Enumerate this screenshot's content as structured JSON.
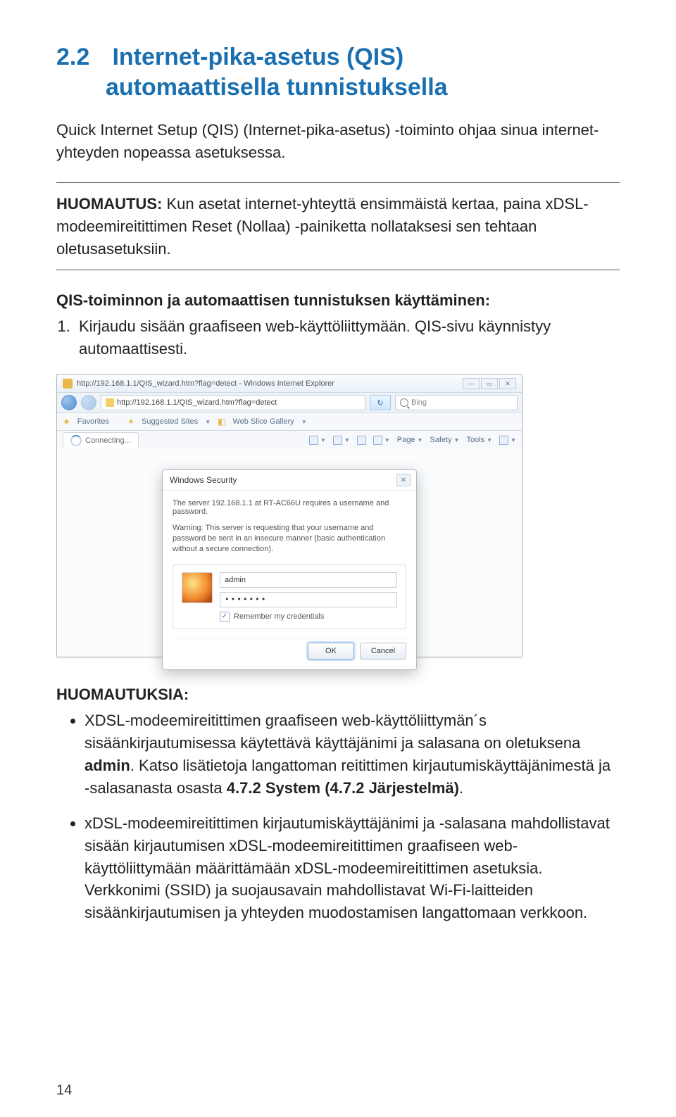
{
  "heading": {
    "number": "2.2",
    "title_line1": "Internet-pika-asetus (QIS)",
    "title_line2": "automaattisella tunnistuksella"
  },
  "intro": "Quick Internet Setup (QIS) (Internet-pika-asetus) -toiminto ohjaa sinua internet-yhteyden nopeassa asetuksessa.",
  "note_block": {
    "label": "HUOMAUTUS:",
    "text": " Kun asetat internet-yhteyttä ensimmäistä kertaa, paina xDSL-modeemireitittimen Reset (Nollaa) -painiketta nollataksesi sen tehtaan oletusasetuksiin."
  },
  "subheading": "QIS-toiminnon ja automaattisen tunnistuksen käyttäminen:",
  "step1": "Kirjaudu sisään graafiseen web-käyttöliittymään. QIS-sivu käynnistyy automaattisesti.",
  "browser": {
    "window_title": "http://192.168.1.1/QIS_wizard.htm?flag=detect - Windows Internet Explorer",
    "url": "http://192.168.1.1/QIS_wizard.htm?flag=detect",
    "search_placeholder": "Bing",
    "favorites_label": "Favorites",
    "suggested_label": "Suggested Sites",
    "webslice_label": "Web Slice Gallery",
    "tab_label": "Connecting...",
    "tool_page": "Page",
    "tool_safety": "Safety",
    "tool_tools": "Tools",
    "dialog": {
      "title": "Windows Security",
      "server_line": "The server 192.168.1.1 at RT-AC66U requires a username and password.",
      "warning": "Warning: This server is requesting that your username and password be sent in an insecure manner (basic authentication without a secure connection).",
      "username": "admin",
      "password_mask": "•••••••",
      "remember": "Remember my credentials",
      "ok": "OK",
      "cancel": "Cancel"
    }
  },
  "notes": {
    "title": "HUOMAUTUKSIA:",
    "item1_a": "XDSL-modeemireitittimen graafiseen web-käyttöliittymän´s sisäänkirjautumisessa käytettävä käyttäjänimi ja salasana on oletuksena ",
    "item1_admin": "admin",
    "item1_b": ". Katso lisätietoja langattoman reitittimen kirjautumiskäyttäjänimestä ja -salasanasta osasta ",
    "item1_ref": "4.7.2 System (4.7.2 Järjestelmä)",
    "item1_c": ".",
    "item2": "xDSL-modeemireitittimen kirjautumiskäyttäjänimi ja -salasana mahdollistavat sisään kirjautumisen xDSL-modeemireitittimen graafiseen web-käyttöliittymään määrittämään xDSL-modeemireitittimen asetuksia. Verkkonimi (SSID) ja suojausavain mahdollistavat Wi-Fi-laitteiden sisäänkirjautumisen ja yhteyden muodostamisen langattomaan verkkoon."
  },
  "page_number": "14"
}
